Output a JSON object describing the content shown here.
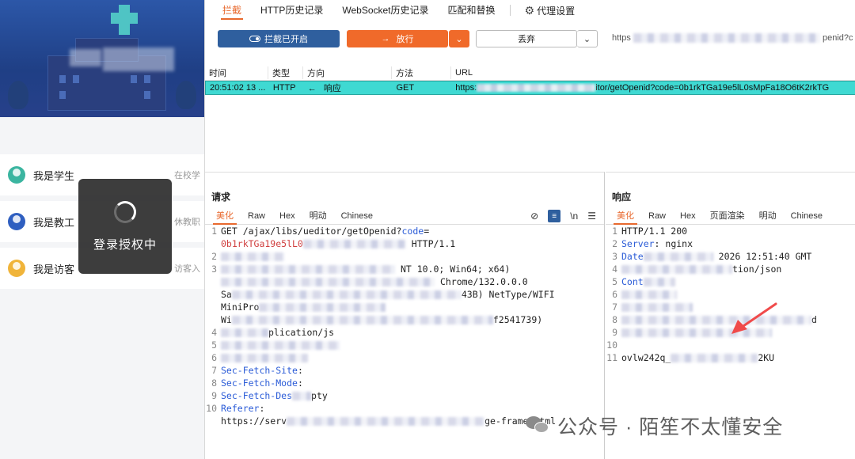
{
  "mobile": {
    "roles": [
      {
        "label": "我是学生",
        "desc": "在校学",
        "icon": "student-icon"
      },
      {
        "label": "我是教工",
        "desc": "休教职",
        "icon": "teacher-icon"
      },
      {
        "label": "我是访客",
        "desc": "访客入",
        "icon": "visitor-icon"
      }
    ],
    "toast": "登录授权中"
  },
  "proxy": {
    "nav": [
      "拦截",
      "HTTP历史记录",
      "WebSocket历史记录",
      "匹配和替换",
      "代理设置"
    ],
    "toolbar": {
      "intercept": "拦截已开启",
      "forward": "放行",
      "drop": "丢弃",
      "url_prefix": "https",
      "url_suffix": "penid?c"
    },
    "table": {
      "headers": [
        "时间",
        "类型",
        "方向",
        "方法",
        "URL"
      ],
      "row": {
        "time": "20:51:02 13 ...",
        "type": "HTTP",
        "dir_arrow": "←",
        "dir": "响应",
        "method": "GET",
        "url_prefix": "https:",
        "url_suffix": "itor/getOpenid?code=0b1rkTGa19e5lL0sMpFa18O6tK2rkTG"
      }
    },
    "request": {
      "title": "请求",
      "tabs": [
        "美化",
        "Raw",
        "Hex",
        "明动",
        "Chinese"
      ],
      "tools": [
        "\\n",
        "☰"
      ],
      "lines": [
        {
          "n": "1",
          "text": "GET /ajax/libs/ueditor/getOpenid?",
          "key": "code",
          "extra": "="
        },
        {
          "n": "",
          "red": "0b1rkTGa19e5lL0",
          "text": "HTTP/1.1"
        },
        {
          "n": "2",
          "text": ""
        },
        {
          "n": "3",
          "text": "NT 10.0; Win64; x64)"
        },
        {
          "n": "",
          "text": "Chrome/132.0.0.0"
        },
        {
          "n": "",
          "text": "Sa",
          "tail": "43B) NetType/WIFI"
        },
        {
          "n": "",
          "text": "MiniPro"
        },
        {
          "n": "",
          "text": "Wi",
          "tail": "f2541739)"
        },
        {
          "n": "4",
          "text": "plication/js"
        },
        {
          "n": "5",
          "text": ""
        },
        {
          "n": "6",
          "text": ""
        },
        {
          "n": "7",
          "key": "Sec-Fetch-Site",
          "text": ":"
        },
        {
          "n": "8",
          "key": "Sec-Fetch-Mode",
          "text": ":"
        },
        {
          "n": "9",
          "key": "Sec-Fetch-Des",
          "text": "pty"
        },
        {
          "n": "10",
          "key": "Referer",
          "text": ":"
        },
        {
          "n": "",
          "text": "https://serv",
          "tail": "ge-frame.html"
        }
      ]
    },
    "response": {
      "title": "响应",
      "tabs": [
        "美化",
        "Raw",
        "Hex",
        "页面渲染",
        "明动",
        "Chinese"
      ],
      "lines": [
        {
          "n": "1",
          "text": "HTTP/1.1 200"
        },
        {
          "n": "2",
          "key": "Server",
          "text": ": nginx"
        },
        {
          "n": "3",
          "key": "Date",
          "text": "2026 12:51:40 GMT"
        },
        {
          "n": "4",
          "text": "tion/json"
        },
        {
          "n": "5",
          "key": "Cont",
          "text": ""
        },
        {
          "n": "6",
          "text": ""
        },
        {
          "n": "7",
          "text": ""
        },
        {
          "n": "8",
          "text": "d"
        },
        {
          "n": "9",
          "text": ""
        },
        {
          "n": "10",
          "text": ""
        },
        {
          "n": "11",
          "text": "ovlw242q_",
          "tail": "2KU"
        }
      ]
    }
  },
  "watermark": "公众号 · 陌笙不太懂安全",
  "colors": {
    "accent": "#e8692e",
    "selected_row": "#3fd9d2",
    "intercept_btn": "#2f5f9e",
    "forward_btn": "#f06a2a"
  }
}
